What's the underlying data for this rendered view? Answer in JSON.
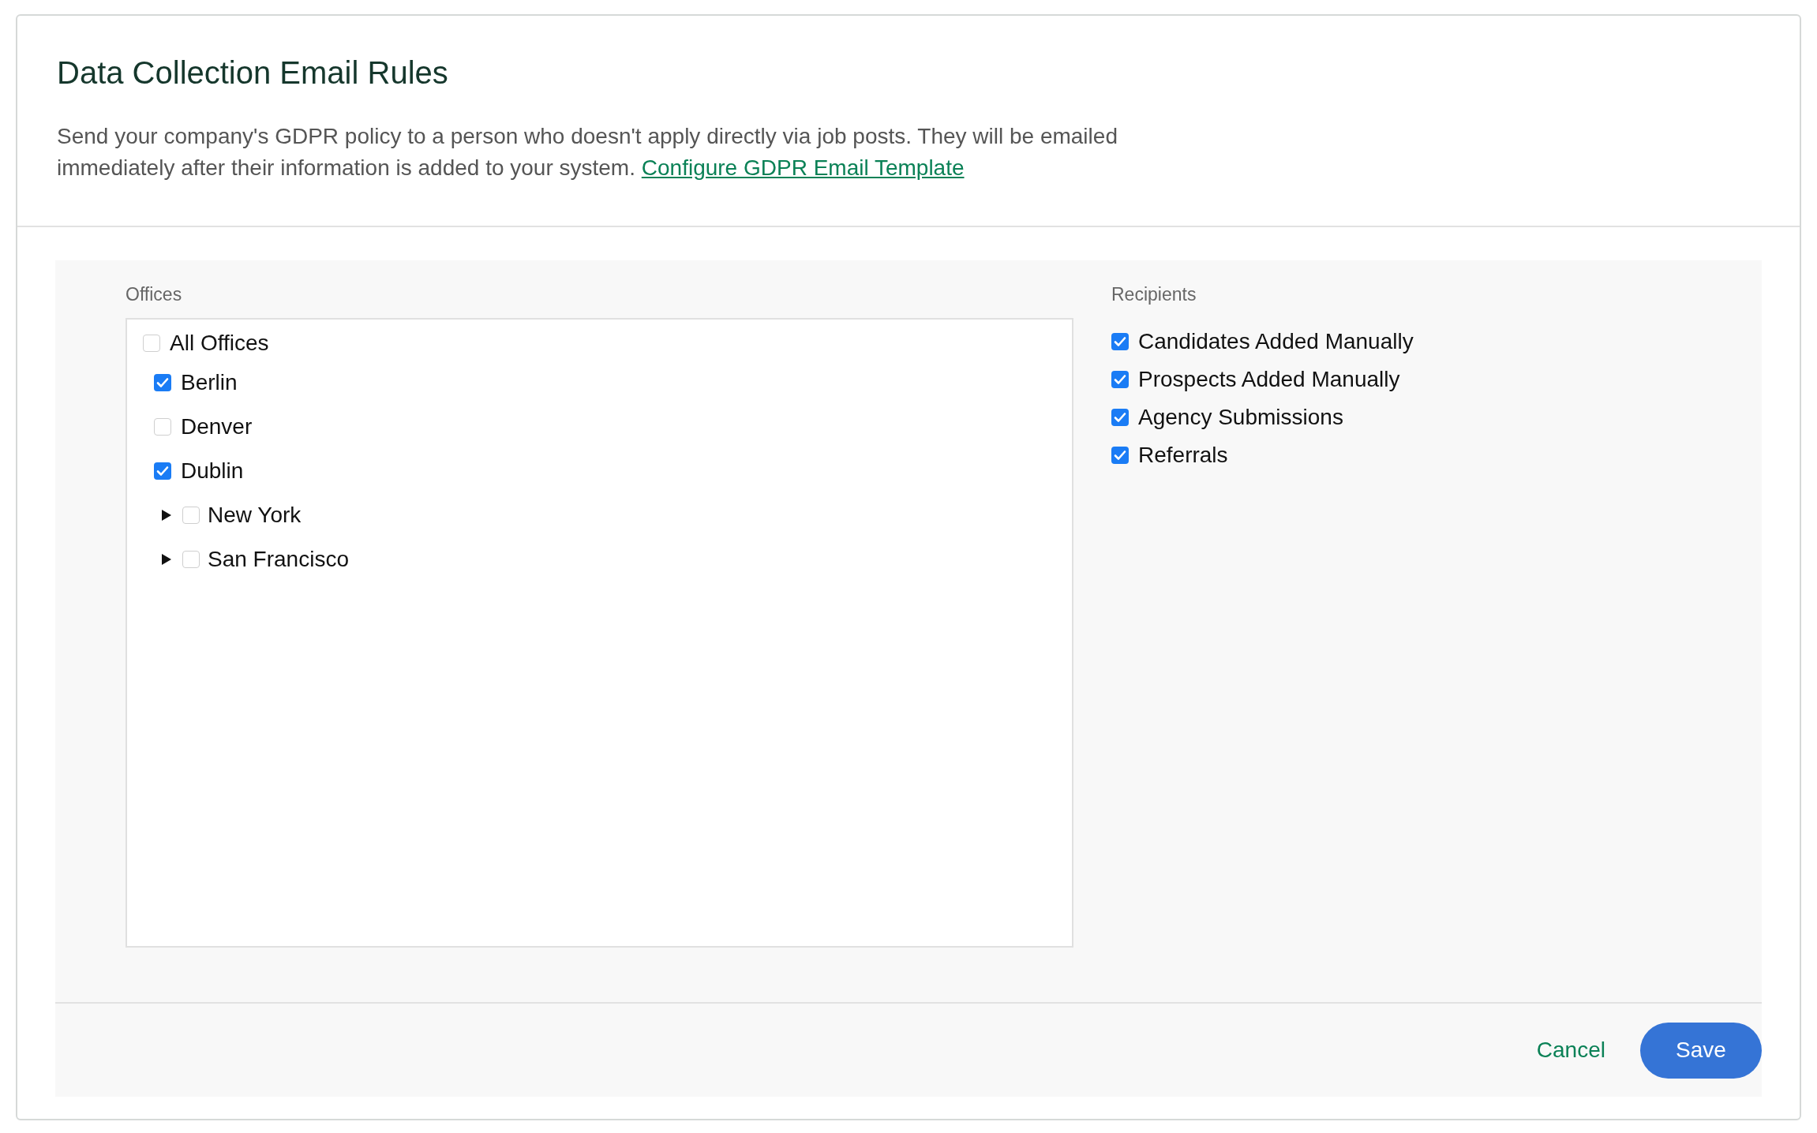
{
  "title": "Data Collection Email Rules",
  "description": "Send your company's GDPR policy to a person who doesn't apply directly via job posts. They will be emailed immediately after their information is added to your system.",
  "description_link": "Configure GDPR Email Template",
  "offices": {
    "label": "Offices",
    "tree": [
      {
        "label": "All Offices",
        "checked": false,
        "kind": "root",
        "children": [
          {
            "label": "Berlin",
            "checked": true,
            "kind": "leaf"
          },
          {
            "label": "Denver",
            "checked": false,
            "kind": "leaf"
          },
          {
            "label": "Dublin",
            "checked": true,
            "kind": "leaf"
          },
          {
            "label": "New York",
            "checked": false,
            "kind": "group",
            "expanded": false
          },
          {
            "label": "San Francisco",
            "checked": false,
            "kind": "group",
            "expanded": false
          }
        ]
      }
    ]
  },
  "recipients": {
    "label": "Recipients",
    "items": [
      {
        "label": "Candidates Added Manually",
        "checked": true
      },
      {
        "label": "Prospects Added Manually",
        "checked": true
      },
      {
        "label": "Agency Submissions",
        "checked": true
      },
      {
        "label": "Referrals",
        "checked": true
      }
    ]
  },
  "buttons": {
    "cancel": "Cancel",
    "save": "Save"
  }
}
